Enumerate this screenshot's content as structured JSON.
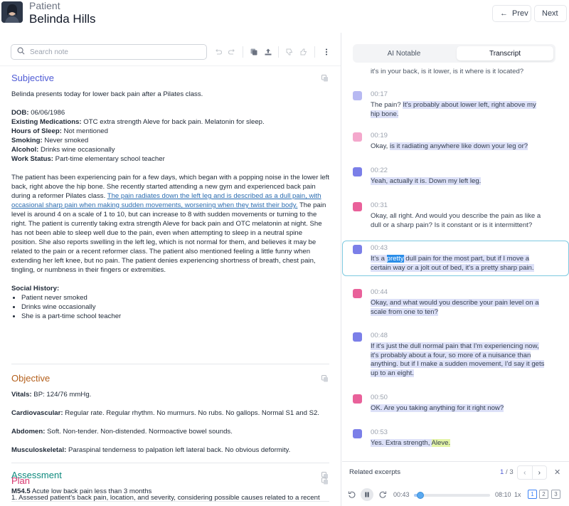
{
  "header": {
    "label": "Patient",
    "name": "Belinda Hills",
    "prev_label": "Prev",
    "next_label": "Next"
  },
  "toolbar": {
    "search_placeholder": "Search note",
    "icons": [
      "undo-icon",
      "redo-icon",
      "copy-icon",
      "export-icon",
      "thumbs-down-icon",
      "thumbs-up-icon",
      "more-icon"
    ]
  },
  "note": {
    "subjective": {
      "title": "Subjective",
      "intro": "Belinda presents today for lower back pain after a Pilates class.",
      "fields": [
        {
          "label": "DOB:",
          "value": "06/06/1986"
        },
        {
          "label": "Existing Medications:",
          "value": "OTC extra strength Aleve for back pain. Melatonin for sleep."
        },
        {
          "label": "Hours of Sleep:",
          "value": "Not mentioned"
        },
        {
          "label": "Smoking:",
          "value": "Never smoked"
        },
        {
          "label": "Alcohol:",
          "value": "Drinks wine occasionally"
        },
        {
          "label": "Work Status:",
          "value": "Part-time elementary school teacher"
        }
      ],
      "hpi_before": "The patient has been experiencing pain for a few days, which began with a popping noise in the lower left back, right above the hip bone. She recently started attending a new gym and experienced back pain during a reformer Pilates class. ",
      "hpi_link": "The pain radiates down the left leg and is described as a dull pain, with occasional sharp pain when making sudden movements, worsening when they twist their body.",
      "hpi_after": " The pain level is around 4 on a scale of 1 to 10, but can increase to 8 with sudden movements or turning to the right. The patient is currently taking extra strength Aleve for back pain and OTC melatonin at night. She has not been able to sleep well due to the pain, even when attempting to sleep in a neutral spine position. She also reports swelling in the left leg, which is not normal for them, and believes it may be related to the pain or a recent reformer class. The patient also mentioned feeling a little funny when extending her left knee, but no pain. The patient denies experiencing shortness of breath, chest pain, tingling, or numbness in their fingers or extremities.",
      "social_label": "Social History:",
      "social_items": [
        "Patient never smoked",
        "Drinks wine occasionally",
        "She is a part-time school teacher"
      ]
    },
    "objective": {
      "title": "Objective",
      "rows": [
        {
          "label": "Vitals:",
          "value": "BP: 124/76 mmHg."
        },
        {
          "label": "Cardiovascular:",
          "value": "Regular rate. Regular rhythm. No murmurs. No rubs. No gallops. Normal S1 and S2."
        },
        {
          "label": "Abdomen:",
          "value": "Soft. Non-tender. Non-distended. Normoactive bowel sounds."
        },
        {
          "label": "Musculoskeletal:",
          "value": "Paraspinal tenderness to palpation left lateral back. No obvious deformity."
        }
      ]
    },
    "assessment": {
      "title": "Assessment",
      "code": "M54.5",
      "text": "Acute low back pain less than 3 months"
    },
    "plan": {
      "title": "Plan",
      "text": "1. Assessed patient's back pain, location, and severity, considering possible causes related to a recent"
    }
  },
  "tabs": {
    "ai": "AI Notable",
    "transcript": "Transcript"
  },
  "transcript": {
    "partial_top": "it's in your back, is it lower, is it where is it located?",
    "messages": [
      {
        "time": "00:17",
        "speaker_color": "#b7b9f2",
        "plain": "The pain? ",
        "hl": "It's probably about lower left, right above my hip bone.",
        "hl_type": "blue"
      },
      {
        "time": "00:19",
        "speaker_color": "#f4a8cc",
        "plain": "Okay, ",
        "hl": "is it radiating anywhere like down your leg or?",
        "hl_type": "blue"
      },
      {
        "time": "00:22",
        "speaker_color": "#7b7fe8",
        "plain": "",
        "hl": "Yeah, actually it is. Down my left leg.",
        "hl_type": "blue"
      },
      {
        "time": "00:31",
        "speaker_color": "#e9619a",
        "plain": "Okay, all right. And would you describe the pain as like a dull or a sharp pain? Is it constant or is it intermittent?",
        "hl": "",
        "hl_type": "none"
      },
      {
        "time": "00:43",
        "speaker_color": "#7b7fe8",
        "pre": "It's a ",
        "selected": "pretty",
        "post": " dull pain for the most part, but if I move a certain way or a jolt out of bed, it's a pretty sharp pain.",
        "hl_type": "active"
      },
      {
        "time": "00:44",
        "speaker_color": "#e9619a",
        "plain": "",
        "hl": "Okay, and what would you describe your pain level on a scale from one to ten?",
        "hl_type": "blue"
      },
      {
        "time": "00:48",
        "speaker_color": "#7b7fe8",
        "plain": "",
        "hl": "If it's just the dull normal pain that I'm experiencing now, it's probably about a four, so more of a nuisance than anything. but if I make a sudden movement, I'd say it gets up to an eight.",
        "hl_type": "blue"
      },
      {
        "time": "00:50",
        "speaker_color": "#e9619a",
        "plain": "",
        "hl": "OK. Are you taking anything for it right now?",
        "hl_type": "blue"
      },
      {
        "time": "00:53",
        "speaker_color": "#7b7fe8",
        "hl": " Yes. Extra strength, ",
        "yellow": "Aleve.",
        "hl_type": "mixed"
      }
    ]
  },
  "related": {
    "label": "Related excerpts",
    "current": "1",
    "total": "/ 3"
  },
  "player": {
    "current_time": "00:43",
    "duration": "08:10",
    "speed": "1x",
    "progress": 0.088,
    "pages": [
      "1",
      "2",
      "3"
    ]
  }
}
